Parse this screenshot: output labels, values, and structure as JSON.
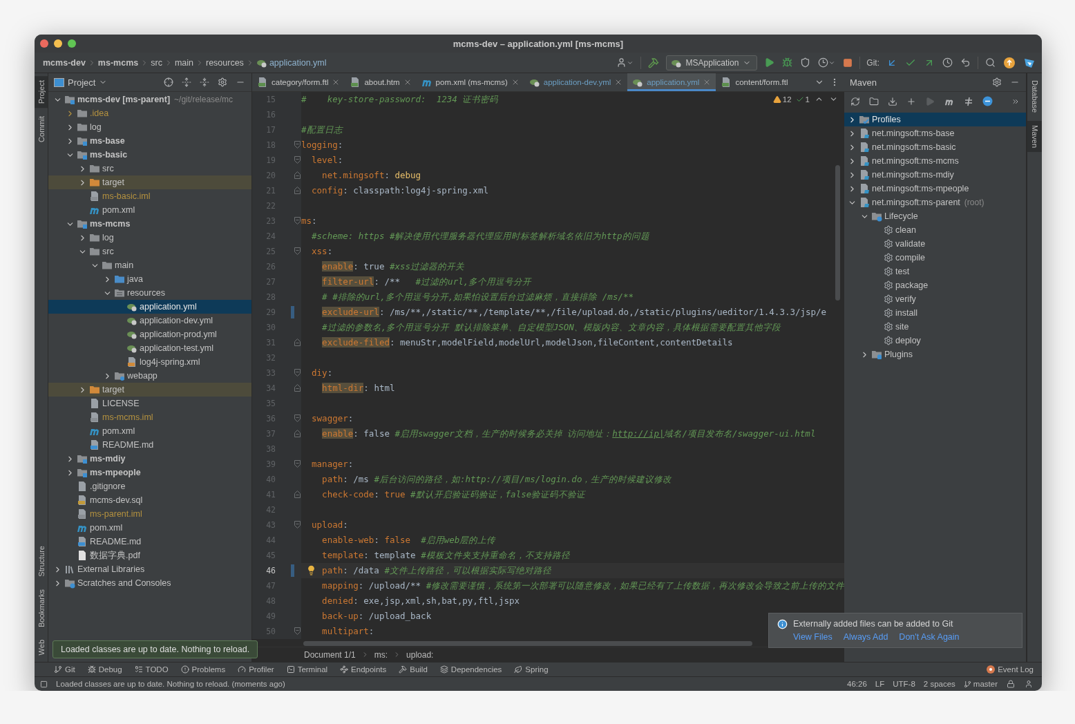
{
  "window": {
    "title": "mcms-dev – application.yml [ms-mcms]"
  },
  "breadcrumb": [
    {
      "label": "mcms-dev",
      "kind": "module"
    },
    {
      "label": "ms-mcms",
      "kind": "module"
    },
    {
      "label": "src",
      "kind": "folder"
    },
    {
      "label": "main",
      "kind": "folder"
    },
    {
      "label": "resources",
      "kind": "folder"
    },
    {
      "label": "application.yml",
      "kind": "yaml"
    }
  ],
  "toolbar": {
    "run_configuration": "MSApplication",
    "git_label": "Git:"
  },
  "left_stripe": {
    "top": [
      {
        "label": "Project",
        "selected": true
      },
      {
        "label": "Commit",
        "selected": false
      }
    ],
    "bottom": [
      {
        "label": "Structure",
        "selected": false
      },
      {
        "label": "Bookmarks",
        "selected": false
      },
      {
        "label": "Web",
        "selected": false
      }
    ]
  },
  "project": {
    "title": "Project",
    "tree": [
      {
        "label": "mcms-dev [ms-parent]",
        "hint": "~/git/release/mc",
        "kind": "module",
        "expanded": true,
        "selected": false,
        "children": [
          {
            "label": ".idea",
            "kind": "ignored-folder",
            "expanded": false,
            "selected": false
          },
          {
            "label": "log",
            "kind": "folder",
            "expanded": false,
            "selected": false
          },
          {
            "label": "ms-base",
            "kind": "module",
            "expanded": false,
            "selected": false
          },
          {
            "label": "ms-basic",
            "kind": "module",
            "expanded": true,
            "selected": false,
            "children": [
              {
                "label": "src",
                "kind": "folder",
                "expanded": false,
                "selected": false
              },
              {
                "label": "target",
                "kind": "excluded",
                "expanded": false,
                "selected": false
              },
              {
                "label": "ms-basic.iml",
                "kind": "iml",
                "selected": false
              },
              {
                "label": "pom.xml",
                "kind": "maven",
                "selected": false
              }
            ]
          },
          {
            "label": "ms-mcms",
            "kind": "module",
            "expanded": true,
            "selected": false,
            "children": [
              {
                "label": "log",
                "kind": "folder",
                "expanded": false,
                "selected": false
              },
              {
                "label": "src",
                "kind": "folder",
                "expanded": true,
                "selected": false,
                "children": [
                  {
                    "label": "main",
                    "kind": "folder",
                    "expanded": true,
                    "selected": false,
                    "children": [
                      {
                        "label": "java",
                        "kind": "source",
                        "expanded": false,
                        "selected": false
                      },
                      {
                        "label": "resources",
                        "kind": "resources",
                        "expanded": true,
                        "selected": false,
                        "children": [
                          {
                            "label": "application.yml",
                            "kind": "yaml",
                            "selected": true
                          },
                          {
                            "label": "application-dev.yml",
                            "kind": "yaml",
                            "selected": false
                          },
                          {
                            "label": "application-prod.yml",
                            "kind": "yaml",
                            "selected": false
                          },
                          {
                            "label": "application-test.yml",
                            "kind": "yaml",
                            "selected": false
                          },
                          {
                            "label": "log4j-spring.xml",
                            "kind": "xml",
                            "selected": false
                          }
                        ]
                      },
                      {
                        "label": "webapp",
                        "kind": "web",
                        "expanded": false,
                        "selected": false
                      }
                    ]
                  }
                ]
              },
              {
                "label": "target",
                "kind": "excluded",
                "expanded": false,
                "selected": false
              },
              {
                "label": "LICENSE",
                "kind": "text",
                "selected": false
              },
              {
                "label": "ms-mcms.iml",
                "kind": "iml",
                "selected": false
              },
              {
                "label": "pom.xml",
                "kind": "maven",
                "selected": false
              },
              {
                "label": "README.md",
                "kind": "md",
                "selected": false
              }
            ]
          },
          {
            "label": "ms-mdiy",
            "kind": "module",
            "expanded": false,
            "selected": false
          },
          {
            "label": "ms-mpeople",
            "kind": "module",
            "expanded": false,
            "selected": false
          },
          {
            "label": ".gitignore",
            "kind": "text",
            "selected": false
          },
          {
            "label": "mcms-dev.sql",
            "kind": "sql",
            "selected": false
          },
          {
            "label": "ms-parent.iml",
            "kind": "iml",
            "selected": false
          },
          {
            "label": "pom.xml",
            "kind": "maven",
            "selected": false
          },
          {
            "label": "README.md",
            "kind": "md",
            "selected": false
          },
          {
            "label": "数据字典.pdf",
            "kind": "pdf",
            "selected": false
          }
        ]
      },
      {
        "label": "External Libraries",
        "kind": "libraries",
        "expanded": false,
        "selected": false
      },
      {
        "label": "Scratches and Consoles",
        "kind": "scratches",
        "expanded": false,
        "selected": false
      }
    ]
  },
  "editor": {
    "tabs": [
      {
        "label": "category/form.ftl",
        "kind": "ftl",
        "selected": false,
        "modified": false,
        "closable": true
      },
      {
        "label": "about.htm",
        "kind": "htm",
        "selected": false,
        "modified": false,
        "closable": true
      },
      {
        "label": "pom.xml (ms-mcms)",
        "kind": "maven",
        "selected": false,
        "modified": false,
        "closable": true
      },
      {
        "label": "application-dev.yml",
        "kind": "yaml",
        "selected": false,
        "modified": true,
        "closable": true
      },
      {
        "label": "application.yml",
        "kind": "yaml",
        "selected": true,
        "modified": true,
        "closable": true
      },
      {
        "label": "content/form.ftl",
        "kind": "ftl",
        "selected": false,
        "modified": false,
        "closable": false
      }
    ],
    "inspections": {
      "warnings": "12",
      "weak_warnings": "1"
    },
    "lines": [
      {
        "number": "15",
        "kind": "plain",
        "current": false,
        "changed": false,
        "tokens": [
          {
            "kind": "comment",
            "text": "#    key-store-password:  1234 证书密码"
          }
        ]
      },
      {
        "number": "16",
        "kind": "plain",
        "current": false,
        "changed": false
      },
      {
        "number": "17",
        "kind": "plain",
        "current": false,
        "changed": false,
        "tokens": [
          {
            "kind": "comment",
            "text": "#配置日志"
          }
        ]
      },
      {
        "number": "18",
        "kind": "fold-start",
        "current": false,
        "changed": false,
        "tokens": [
          {
            "kind": "key",
            "text": "logging"
          },
          {
            "kind": "value",
            "text": ":"
          }
        ]
      },
      {
        "number": "19",
        "kind": "fold-start",
        "current": false,
        "changed": false,
        "tokens": [
          {
            "kind": "key",
            "text": "  level"
          },
          {
            "kind": "value",
            "text": ":"
          }
        ]
      },
      {
        "number": "20",
        "kind": "fold-end",
        "current": false,
        "changed": false,
        "tokens": [
          {
            "kind": "key",
            "text": "    net.mingsoft"
          },
          {
            "kind": "value",
            "text": ": "
          },
          {
            "kind": "string",
            "text": "debug"
          }
        ]
      },
      {
        "number": "21",
        "kind": "fold-end",
        "current": false,
        "changed": false,
        "tokens": [
          {
            "kind": "key",
            "text": "  config"
          },
          {
            "kind": "value",
            "text": ": classpath:log4j-spring.xml"
          }
        ]
      },
      {
        "number": "22",
        "kind": "plain",
        "current": false,
        "changed": false
      },
      {
        "number": "23",
        "kind": "fold-start",
        "current": false,
        "changed": false,
        "tokens": [
          {
            "kind": "key",
            "text": "ms"
          },
          {
            "kind": "value",
            "text": ":"
          }
        ]
      },
      {
        "number": "24",
        "kind": "plain",
        "current": false,
        "changed": false,
        "tokens": [
          {
            "kind": "comment",
            "text": "  #scheme: https #解决使用代理服务器代理应用时标签解析域名依旧为http的问题"
          }
        ]
      },
      {
        "number": "25",
        "kind": "fold-start",
        "current": false,
        "changed": false,
        "tokens": [
          {
            "kind": "key",
            "text": "  xss"
          },
          {
            "kind": "value",
            "text": ":"
          }
        ]
      },
      {
        "number": "26",
        "kind": "plain",
        "current": false,
        "changed": false,
        "tokens": [
          {
            "kind": "marked",
            "text": "    enable"
          },
          {
            "kind": "value",
            "text": ": true "
          },
          {
            "kind": "comment",
            "text": "#xss过滤器的开关"
          }
        ]
      },
      {
        "number": "27",
        "kind": "plain",
        "current": false,
        "changed": false,
        "tokens": [
          {
            "kind": "marked",
            "text": "    filter-url"
          },
          {
            "kind": "value",
            "text": ": /**   "
          },
          {
            "kind": "comment",
            "text": "#过滤的url,多个用逗号分开"
          }
        ]
      },
      {
        "number": "28",
        "kind": "plain",
        "current": false,
        "changed": false,
        "tokens": [
          {
            "kind": "comment",
            "text": "    # #排除的url,多个用逗号分开,如果怕设置后台过滤麻烦，直接排除 /ms/**"
          }
        ]
      },
      {
        "number": "29",
        "kind": "plain",
        "current": false,
        "changed": true,
        "tokens": [
          {
            "kind": "marked",
            "text": "    exclude-url"
          },
          {
            "kind": "value",
            "text": ": /ms/**,/static/**,/template/**,/file/upload.do,/static/plugins/ueditor/1.4.3.3/jsp/e"
          }
        ]
      },
      {
        "number": "30",
        "kind": "plain",
        "current": false,
        "changed": false,
        "tokens": [
          {
            "kind": "comment",
            "text": "    #过滤的参数名,多个用逗号分开 默认排除菜单、自定模型JSON、模版内容、文章内容，具体根据需要配置其他字段"
          }
        ]
      },
      {
        "number": "31",
        "kind": "fold-end",
        "current": false,
        "changed": false,
        "tokens": [
          {
            "kind": "marked",
            "text": "    exclude-filed"
          },
          {
            "kind": "value",
            "text": ": menuStr,modelField,modelUrl,modelJson,fileContent,contentDetails"
          }
        ]
      },
      {
        "number": "32",
        "kind": "plain",
        "current": false,
        "changed": false
      },
      {
        "number": "33",
        "kind": "fold-start",
        "current": false,
        "changed": false,
        "tokens": [
          {
            "kind": "key",
            "text": "  diy"
          },
          {
            "kind": "value",
            "text": ":"
          }
        ]
      },
      {
        "number": "34",
        "kind": "fold-end",
        "current": false,
        "changed": false,
        "tokens": [
          {
            "kind": "marked",
            "text": "    html-dir"
          },
          {
            "kind": "value",
            "text": ": html"
          }
        ]
      },
      {
        "number": "35",
        "kind": "plain",
        "current": false,
        "changed": false
      },
      {
        "number": "36",
        "kind": "fold-start",
        "current": false,
        "changed": false,
        "tokens": [
          {
            "kind": "key",
            "text": "  swagger"
          },
          {
            "kind": "value",
            "text": ":"
          }
        ]
      },
      {
        "number": "37",
        "kind": "fold-end",
        "current": false,
        "changed": false,
        "tokens": [
          {
            "kind": "marked",
            "text": "    enable"
          },
          {
            "kind": "value",
            "text": ": false "
          },
          {
            "kind": "comment",
            "text": "#启用swagger文档，生产的时候务必关掉 访问地址："
          },
          {
            "kind": "link",
            "text": "http://ip|"
          },
          {
            "kind": "comment",
            "text": "域名/项目发布名/swagger-ui.html"
          }
        ]
      },
      {
        "number": "38",
        "kind": "plain",
        "current": false,
        "changed": false
      },
      {
        "number": "39",
        "kind": "fold-start",
        "current": false,
        "changed": false,
        "tokens": [
          {
            "kind": "key",
            "text": "  manager"
          },
          {
            "kind": "value",
            "text": ":"
          }
        ]
      },
      {
        "number": "40",
        "kind": "plain",
        "current": false,
        "changed": false,
        "tokens": [
          {
            "kind": "key",
            "text": "    path"
          },
          {
            "kind": "value",
            "text": ": /ms "
          },
          {
            "kind": "comment",
            "text": "#后台访问的路径，如:http://项目/ms/login.do，生产的时候建议修改"
          }
        ]
      },
      {
        "number": "41",
        "kind": "fold-end",
        "current": false,
        "changed": false,
        "tokens": [
          {
            "kind": "key",
            "text": "    check-code"
          },
          {
            "kind": "value",
            "text": ": "
          },
          {
            "kind": "keyword",
            "text": "true"
          },
          {
            "kind": "comment",
            "text": " #默认开启验证码验证，false验证码不验证"
          }
        ]
      },
      {
        "number": "42",
        "kind": "plain",
        "current": false,
        "changed": false
      },
      {
        "number": "43",
        "kind": "fold-start",
        "current": false,
        "changed": false,
        "tokens": [
          {
            "kind": "key",
            "text": "  upload"
          },
          {
            "kind": "value",
            "text": ":"
          }
        ]
      },
      {
        "number": "44",
        "kind": "plain",
        "current": false,
        "changed": false,
        "tokens": [
          {
            "kind": "key",
            "text": "    enable-web"
          },
          {
            "kind": "value",
            "text": ": "
          },
          {
            "kind": "keyword",
            "text": "false"
          },
          {
            "kind": "comment",
            "text": "  #启用web层的上传"
          }
        ]
      },
      {
        "number": "45",
        "kind": "plain",
        "current": false,
        "changed": false,
        "tokens": [
          {
            "kind": "key",
            "text": "    template"
          },
          {
            "kind": "value",
            "text": ": template "
          },
          {
            "kind": "comment",
            "text": "#模板文件夹支持重命名，不支持路径"
          }
        ]
      },
      {
        "number": "46",
        "kind": "plain",
        "current": true,
        "changed": true,
        "tokens": [
          {
            "kind": "key",
            "text": "    path"
          },
          {
            "kind": "value",
            "text": ": /data "
          },
          {
            "kind": "comment",
            "text": "#文件上传路径，可以根据实际写绝对路径"
          }
        ]
      },
      {
        "number": "47",
        "kind": "plain",
        "current": false,
        "changed": false,
        "tokens": [
          {
            "kind": "key",
            "text": "    mapping"
          },
          {
            "kind": "value",
            "text": ": /upload/** "
          },
          {
            "kind": "comment",
            "text": "#修改需要谨慎，系统第一次部署可以随意修改，如果已经有了上传数据，再次修改会导致之前上传的文件"
          }
        ]
      },
      {
        "number": "48",
        "kind": "plain",
        "current": false,
        "changed": false,
        "tokens": [
          {
            "kind": "key",
            "text": "    denied"
          },
          {
            "kind": "value",
            "text": ": exe,jsp,xml,sh,bat,py,ftl,jspx"
          }
        ]
      },
      {
        "number": "49",
        "kind": "plain",
        "current": false,
        "changed": false,
        "tokens": [
          {
            "kind": "key",
            "text": "    back-up"
          },
          {
            "kind": "value",
            "text": ": /upload_back"
          }
        ]
      },
      {
        "number": "50",
        "kind": "fold-start",
        "current": false,
        "changed": false,
        "tokens": [
          {
            "kind": "key",
            "text": "    multipart"
          },
          {
            "kind": "value",
            "text": ":"
          }
        ]
      }
    ],
    "path": [
      "Document 1/1",
      "ms:",
      "upload:"
    ]
  },
  "maven": {
    "title": "Maven",
    "tree": [
      {
        "label": "Profiles",
        "kind": "profiles",
        "expanded": false,
        "selected": true
      },
      {
        "label": "net.mingsoft:ms-base",
        "kind": "maven-module",
        "expanded": false,
        "selected": false
      },
      {
        "label": "net.mingsoft:ms-basic",
        "kind": "maven-module",
        "expanded": false,
        "selected": false
      },
      {
        "label": "net.mingsoft:ms-mcms",
        "kind": "maven-module",
        "expanded": false,
        "selected": false
      },
      {
        "label": "net.mingsoft:ms-mdiy",
        "kind": "maven-module",
        "expanded": false,
        "selected": false
      },
      {
        "label": "net.mingsoft:ms-mpeople",
        "kind": "maven-module",
        "expanded": false,
        "selected": false
      },
      {
        "label": "net.mingsoft:ms-parent",
        "hint": "(root)",
        "kind": "maven-module",
        "expanded": true,
        "selected": false,
        "children": [
          {
            "label": "Lifecycle",
            "kind": "lifecycle",
            "expanded": true,
            "selected": false,
            "children": [
              {
                "label": "clean",
                "kind": "goal",
                "selected": false
              },
              {
                "label": "validate",
                "kind": "goal",
                "selected": false
              },
              {
                "label": "compile",
                "kind": "goal",
                "selected": false
              },
              {
                "label": "test",
                "kind": "goal",
                "selected": false
              },
              {
                "label": "package",
                "kind": "goal",
                "selected": false
              },
              {
                "label": "verify",
                "kind": "goal",
                "selected": false
              },
              {
                "label": "install",
                "kind": "goal",
                "selected": false
              },
              {
                "label": "site",
                "kind": "goal",
                "selected": false
              },
              {
                "label": "deploy",
                "kind": "goal",
                "selected": false
              }
            ]
          },
          {
            "label": "Plugins",
            "kind": "plugins",
            "expanded": false,
            "selected": false
          }
        ]
      }
    ]
  },
  "right_stripe": [
    {
      "label": "Database",
      "selected": false
    },
    {
      "label": "Maven",
      "selected": true
    }
  ],
  "tooltip": "Loaded classes are up to date. Nothing to reload.",
  "notification": {
    "message": "Externally added files can be added to Git",
    "actions": [
      "View Files",
      "Always Add",
      "Don't Ask Again"
    ]
  },
  "tool_windows": [
    "Git",
    "Debug",
    "TODO",
    "Problems",
    "Profiler",
    "Terminal",
    "Endpoints",
    "Build",
    "Dependencies",
    "Spring"
  ],
  "event_log": "Event Log",
  "status_bar": {
    "message": "Loaded classes are up to date. Nothing to reload. (moments ago)",
    "position": "46:26",
    "line_separator": "LF",
    "encoding": "UTF-8",
    "indent": "2 spaces",
    "branch": "master"
  }
}
